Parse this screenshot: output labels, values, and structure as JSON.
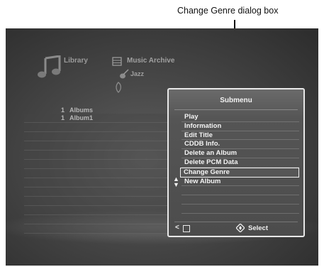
{
  "callout": {
    "label": "Change Genre dialog box"
  },
  "header": {
    "library_label": "Library",
    "archive_label": "Music Archive",
    "genre_label": "Jazz"
  },
  "tree": {
    "items": [
      {
        "count": "1",
        "label": "Albums"
      },
      {
        "count": "1",
        "label": "Album1"
      }
    ]
  },
  "dialog": {
    "title": "Submenu",
    "items": [
      {
        "label": "Play"
      },
      {
        "label": "Information"
      },
      {
        "label": "Edit Title"
      },
      {
        "label": "CDDB Info."
      },
      {
        "label": "Delete an Album"
      },
      {
        "label": "Delete PCM Data"
      },
      {
        "label": "Change Genre",
        "selected": true
      },
      {
        "label": "New Album"
      }
    ],
    "footer": {
      "select_label": "Select"
    }
  },
  "colors": {
    "screen_bg": "#464646",
    "dialog_border": "#e8e8e8",
    "text": "#f4f4f4"
  }
}
